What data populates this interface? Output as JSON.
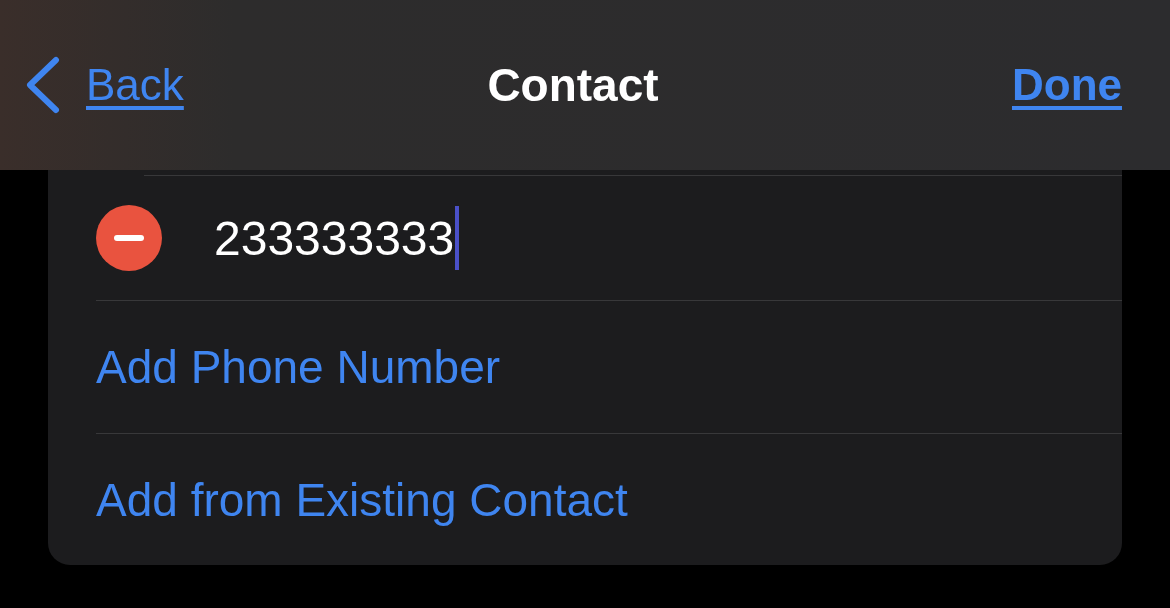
{
  "nav": {
    "back_label": "Back",
    "title": "Contact",
    "done_label": "Done"
  },
  "phone_entry": {
    "value": "233333333",
    "focused": true
  },
  "actions": [
    {
      "label": "Add Phone Number"
    },
    {
      "label": "Add from Existing Contact"
    }
  ]
}
